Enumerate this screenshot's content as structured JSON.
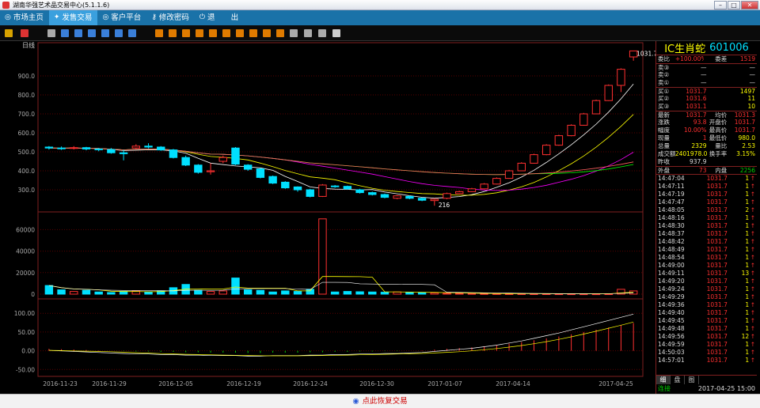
{
  "window": {
    "title": "湖南华强艺术品交易中心(5.1.1.6)",
    "min": "–",
    "max": "□",
    "close": "✕"
  },
  "nav": [
    {
      "icon": "globe-icon",
      "glyph": "◎",
      "label": "市场主页"
    },
    {
      "icon": "trade-icon",
      "glyph": "✦",
      "label": "发售交易"
    },
    {
      "icon": "globe-icon",
      "glyph": "◎",
      "label": "客户平台"
    },
    {
      "icon": "key-icon",
      "glyph": "⚷",
      "label": "修改密码"
    },
    {
      "icon": "power-icon",
      "glyph": "⏻",
      "label": "退"
    },
    {
      "icon": "",
      "glyph": "",
      "label": "出"
    }
  ],
  "toolbar_colors": [
    "#d9a300",
    "#d33",
    "#aaa",
    "#3a7fd9",
    "#3a7fd9",
    "#3a7fd9",
    "#3a7fd9",
    "#3a7fd9",
    "#3a7fd9",
    "#e07b00",
    "#e07b00",
    "#e07b00",
    "#e07b00",
    "#e07b00",
    "#e07b00",
    "#e07b00",
    "#e07b00",
    "#e07b00",
    "#e07b00",
    "#aaa",
    "#aaa",
    "#aaa",
    "#ccc"
  ],
  "chart_data": {
    "type": "candlestick",
    "period_label": "日线",
    "last_price_label": "1031.7",
    "low_label": "216",
    "price_axis": {
      "ticks": [
        "900.0",
        "800.0",
        "700.0",
        "600.0",
        "500.0",
        "400.0",
        "300.0"
      ],
      "ylim": [
        200,
        1050
      ]
    },
    "volume_axis": {
      "ticks": [
        "60000",
        "40000",
        "20000",
        "0"
      ],
      "ylim": [
        0,
        75000
      ]
    },
    "macd_axis": {
      "ticks": [
        "100.00",
        "50.00",
        "0.00",
        "-50.00"
      ],
      "ylim": [
        -60,
        130
      ]
    },
    "dates": [
      "2016-11-23",
      "2016-11-29",
      "2016-12-05",
      "2016-12-19",
      "2016-12-24",
      "2016-12-30",
      "2017-01-07",
      "2017-04-14",
      "2017-04-25"
    ],
    "colors": {
      "up": "#ff3030",
      "down": "#00e0ff",
      "grid": "#5a0000"
    },
    "candles": [
      [
        525,
        520,
        530,
        512
      ],
      [
        520,
        518,
        528,
        510
      ],
      [
        518,
        522,
        530,
        512
      ],
      [
        522,
        515,
        526,
        508
      ],
      [
        515,
        512,
        520,
        503
      ],
      [
        512,
        495,
        520,
        490
      ],
      [
        495,
        490,
        510,
        455
      ],
      [
        520,
        530,
        540,
        515
      ],
      [
        530,
        525,
        545,
        518
      ],
      [
        525,
        510,
        530,
        505
      ],
      [
        510,
        470,
        515,
        465
      ],
      [
        470,
        430,
        480,
        425
      ],
      [
        430,
        392,
        435,
        385
      ],
      [
        395,
        400,
        440,
        380
      ],
      [
        450,
        470,
        480,
        440
      ],
      [
        520,
        435,
        525,
        430
      ],
      [
        430,
        408,
        435,
        400
      ],
      [
        410,
        365,
        415,
        360
      ],
      [
        370,
        335,
        375,
        330
      ],
      [
        340,
        310,
        345,
        305
      ],
      [
        315,
        300,
        318,
        290
      ],
      [
        300,
        265,
        305,
        260
      ],
      [
        265,
        325,
        330,
        262
      ],
      [
        320,
        316,
        325,
        310
      ],
      [
        318,
        305,
        322,
        300
      ],
      [
        300,
        285,
        305,
        280
      ],
      [
        285,
        275,
        290,
        270
      ],
      [
        275,
        260,
        280,
        255
      ],
      [
        255,
        268,
        272,
        250
      ],
      [
        265,
        255,
        270,
        250
      ],
      [
        255,
        245,
        258,
        240
      ],
      [
        243,
        250,
        255,
        216
      ],
      [
        255,
        280,
        285,
        250
      ],
      [
        280,
        290,
        295,
        278
      ],
      [
        290,
        305,
        310,
        288
      ],
      [
        305,
        330,
        335,
        302
      ],
      [
        330,
        360,
        365,
        328
      ],
      [
        360,
        400,
        405,
        358
      ],
      [
        400,
        440,
        445,
        398
      ],
      [
        440,
        485,
        490,
        438
      ],
      [
        485,
        535,
        540,
        482
      ],
      [
        535,
        585,
        590,
        532
      ],
      [
        585,
        640,
        645,
        582
      ],
      [
        640,
        700,
        705,
        638
      ],
      [
        700,
        770,
        775,
        698
      ],
      [
        770,
        850,
        855,
        768
      ],
      [
        850,
        935,
        940,
        815
      ],
      [
        1000,
        1031.7,
        1031.7,
        980
      ]
    ],
    "volumes": [
      8000,
      4000,
      2500,
      3500,
      2000,
      1500,
      2500,
      3000,
      2000,
      3000,
      6000,
      9000,
      3500,
      2500,
      3000,
      15000,
      4000,
      3500,
      2000,
      3000,
      2500,
      4500,
      70000,
      2000,
      2500,
      2200,
      2000,
      1800,
      2000,
      1600,
      1500,
      1200,
      800,
      700,
      600,
      500,
      450,
      400,
      400,
      380,
      360,
      340,
      320,
      300,
      300,
      350,
      4500,
      3000
    ],
    "macd_bars": [
      5,
      4,
      3,
      2,
      1,
      0,
      -1,
      -2,
      -2,
      -3,
      -3,
      -4,
      -4,
      -5,
      -5,
      -5,
      -6,
      -6,
      -5,
      -5,
      -5,
      -4,
      -4,
      -3,
      -3,
      -2,
      -2,
      -1,
      -1,
      0,
      1,
      3,
      5,
      7,
      9,
      12,
      15,
      19,
      23,
      28,
      33,
      38,
      44,
      50,
      56,
      62,
      68,
      74
    ]
  },
  "panel": {
    "stock_name": "IC生肖蛇",
    "stock_code": "601006",
    "top_rows": [
      {
        "l": "委比",
        "v": "+100.00%",
        "l2": "委差",
        "v2": "1519"
      }
    ],
    "sell_rows": [
      {
        "l": "卖③",
        "p": "—",
        "q": "—"
      },
      {
        "l": "卖②",
        "p": "—",
        "q": "—"
      },
      {
        "l": "卖①",
        "p": "—",
        "q": "—"
      }
    ],
    "buy_rows": [
      {
        "l": "买①",
        "p": "1031.7",
        "q": "1497"
      },
      {
        "l": "买②",
        "p": "1031.6",
        "q": "11"
      },
      {
        "l": "买③",
        "p": "1031.1",
        "q": "10"
      }
    ],
    "stats": [
      {
        "l": "最新",
        "v": "1031.7",
        "l2": "均价",
        "v2": "1031.3"
      },
      {
        "l": "涨跌",
        "v": "93.8",
        "l2": "开盘价",
        "v2": "1031.7"
      },
      {
        "l": "幅度",
        "v": "10.00%",
        "l2": "最高价",
        "v2": "1031.7"
      },
      {
        "l": "现量",
        "v": "1",
        "l2": "最低价",
        "v2": "980.0"
      },
      {
        "l": "总量",
        "v": "2329",
        "l2": "量比",
        "v2": "2.53"
      },
      {
        "l": "成交额",
        "v": "2401978.0",
        "l2": "换手率",
        "v2": "3.15%"
      },
      {
        "l": "昨收",
        "v": "937.9",
        "l2": "",
        "v2": ""
      }
    ],
    "outer_inner": {
      "l": "外盘",
      "v": "73",
      "l2": "内盘",
      "v2": "2256"
    },
    "ticks": [
      [
        "14:47:04",
        "1031.7",
        "1"
      ],
      [
        "14:47:11",
        "1031.7",
        "1"
      ],
      [
        "14:47:19",
        "1031.7",
        "1"
      ],
      [
        "14:47:47",
        "1031.7",
        "1"
      ],
      [
        "14:48:05",
        "1031.7",
        "2"
      ],
      [
        "14:48:16",
        "1031.7",
        "1"
      ],
      [
        "14:48:30",
        "1031.7",
        "1"
      ],
      [
        "14:48:37",
        "1031.7",
        "1"
      ],
      [
        "14:48:42",
        "1031.7",
        "1"
      ],
      [
        "14:48:49",
        "1031.7",
        "1"
      ],
      [
        "14:48:54",
        "1031.7",
        "1"
      ],
      [
        "14:49:00",
        "1031.7",
        "1"
      ],
      [
        "14:49:11",
        "1031.7",
        "13"
      ],
      [
        "14:49:20",
        "1031.7",
        "1"
      ],
      [
        "14:49:24",
        "1031.7",
        "1"
      ],
      [
        "14:49:29",
        "1031.7",
        "1"
      ],
      [
        "14:49:36",
        "1031.7",
        "1"
      ],
      [
        "14:49:40",
        "1031.7",
        "1"
      ],
      [
        "14:49:45",
        "1031.7",
        "1"
      ],
      [
        "14:49:48",
        "1031.7",
        "1"
      ],
      [
        "14:49:56",
        "1031.7",
        "12"
      ],
      [
        "14:49:59",
        "1031.7",
        "1"
      ],
      [
        "14:50:03",
        "1031.7",
        "1"
      ],
      [
        "14:57:01",
        "1031.7",
        "1"
      ]
    ],
    "tick_arrow": "↑",
    "tabs": [
      "细",
      "盘",
      "图"
    ],
    "status_conn": "连接",
    "status_time": "2017-04-25 15:00"
  },
  "bottom": {
    "label": "点此恢复交易"
  }
}
